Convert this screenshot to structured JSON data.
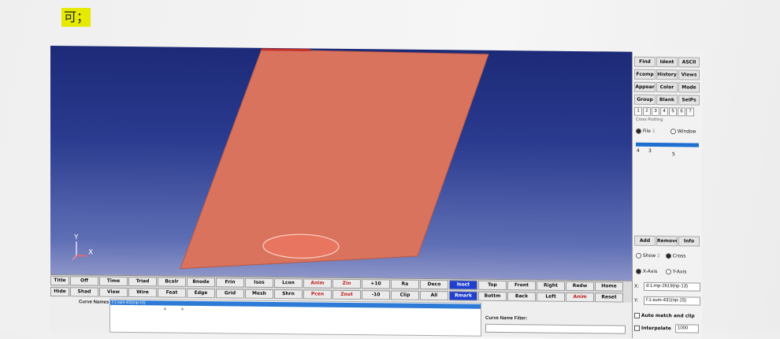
{
  "note": {
    "text": "可；"
  },
  "viewport": {
    "axis_y": "Y",
    "axis_x": "X",
    "colors": {
      "plate": "#d9735e",
      "hole": "#e8755f",
      "bg_top": "#1d2a78",
      "bg_bottom": "#8d95c8"
    }
  },
  "side": {
    "buttons": [
      "Find",
      "Ident",
      "ASCII",
      "Fcomp",
      "History",
      "Views",
      "Appear",
      "Color",
      "Mode",
      "Group",
      "Blank",
      "SelPs"
    ],
    "numbers": [
      "1",
      "2",
      "3",
      "4",
      "5",
      "6",
      "7"
    ],
    "cross_plot": "Cross Plotting",
    "file_label": "File",
    "file_num": "1",
    "window_label": "Window",
    "list": [
      "4",
      "3",
      "5"
    ],
    "add": "Add",
    "remove": "Remove",
    "info": "Info",
    "show": "Show",
    "show_num": "2",
    "cross": "Cross",
    "xaxis": "X-Axis",
    "yaxis": "Y-Axis",
    "field_x_label": "X:",
    "field_x": "d:1:mp-2619(np-13)",
    "field_y_label": "Y:",
    "field_y": "f:1:sum-431(np-15)",
    "auto_match": "Auto match and clip",
    "interpolate": "Interpolate",
    "interp_val": "1000"
  },
  "toolbar": {
    "row1": [
      "Title",
      "Off",
      "Time",
      "Triad",
      "Bcolr",
      "Bnode",
      "Frin",
      "Isos",
      "Lcon",
      "Anim",
      "Zin",
      "+10",
      "Ra",
      "Deco",
      "Isoct",
      "Top",
      "Front",
      "Right",
      "Redw",
      "Home"
    ],
    "row2": [
      "Hide",
      "Shad",
      "View",
      "Wire",
      "Feat",
      "Edge",
      "Grid",
      "Mesh",
      "Shrn",
      "Pcen",
      "Zout",
      "-10",
      "Clip",
      "All",
      "Rmark",
      "Bottm",
      "Back",
      "Left",
      "Anim",
      "Reset"
    ]
  },
  "bottom": {
    "curve_label": "Curve Names",
    "curve_selected": "f:1:sum-431(np-15)",
    "curve_nums": [
      "4",
      "4"
    ],
    "filter_label": "Curve Name Filter:"
  }
}
